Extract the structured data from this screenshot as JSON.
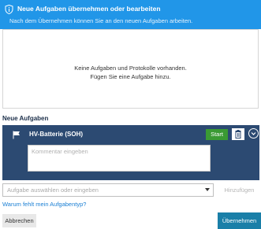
{
  "header": {
    "title": "Neue Aufgaben übernehmen oder bearbeiten",
    "subtitle": "Nach dem Übernehmen können Sie an den neuen Aufgaben arbeiten."
  },
  "empty_state": {
    "line1": "Keine Aufgaben und Protokolle vorhanden.",
    "line2": "Fügen Sie eine Aufgabe hinzu."
  },
  "new_tasks": {
    "section_label": "Neue Aufgaben",
    "task": {
      "name": "HV-Batterie (SOH)",
      "start_label": "Start",
      "comment_placeholder": "Kommentar eingeben"
    }
  },
  "task_select": {
    "placeholder": "Aufgabe auswählen oder eingeben",
    "add_label": "Hinzufügen"
  },
  "help_link": "Warum fehlt mein Aufgabentyp?",
  "footer": {
    "cancel_label": "Abbrechen",
    "apply_label": "Übernehmen"
  },
  "colors": {
    "header_blue": "#2196e8",
    "task_navy": "#2c4a72",
    "start_green": "#3a9a33",
    "apply_teal": "#1a7fa8"
  }
}
